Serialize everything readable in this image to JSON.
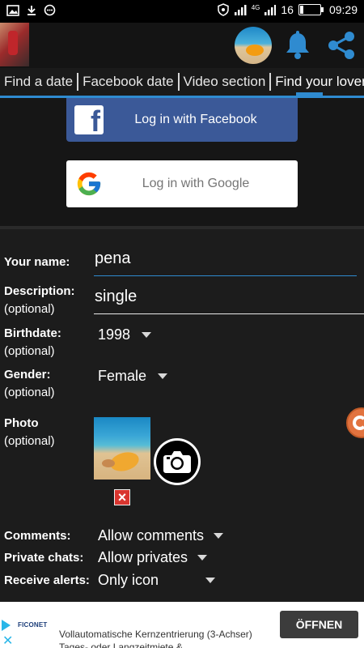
{
  "status_bar": {
    "network_label": "4G",
    "battery_level": "16",
    "battery_fraction": 0.16,
    "time": "09:29",
    "left_icons": [
      "image-icon",
      "download-icon",
      "chat-bubble-icon"
    ],
    "right_icons": [
      "shield-icon",
      "signal-icon",
      "signal-4g-icon",
      "battery-icon"
    ]
  },
  "header": {
    "icons": [
      "bell-icon",
      "share-icon"
    ],
    "accent_color": "#2f8bd0"
  },
  "tabs": [
    {
      "label": "Find a date"
    },
    {
      "label": "Facebook date"
    },
    {
      "label": "Video section"
    },
    {
      "label": "Find your lover"
    }
  ],
  "login": {
    "facebook_label": "Log in with Facebook",
    "google_label": "Log in with Google",
    "facebook_color": "#3b5998"
  },
  "form": {
    "name_label": "Your name:",
    "name_value": "pena",
    "description_label": "Description:",
    "description_optional": "(optional)",
    "description_value": "single",
    "birthdate_label": "Birthdate:",
    "birthdate_optional": "(optional)",
    "birthdate_value": "1998",
    "gender_label": "Gender:",
    "gender_optional": "(optional)",
    "gender_value": "Female",
    "photo_label": "Photo",
    "photo_optional": "(optional)",
    "comments_label": "Comments:",
    "comments_value": "Allow comments",
    "private_chats_label": "Private chats:",
    "private_chats_value": "Allow privates",
    "receive_alerts_label": "Receive alerts:",
    "receive_alerts_value": "Only icon"
  },
  "ad": {
    "brand": "FICONET",
    "text": "Vollautomatische Kernzentrierung (3-Achser) Tages- oder Langzeitmiete &",
    "button_label": "ÖFFNEN"
  }
}
